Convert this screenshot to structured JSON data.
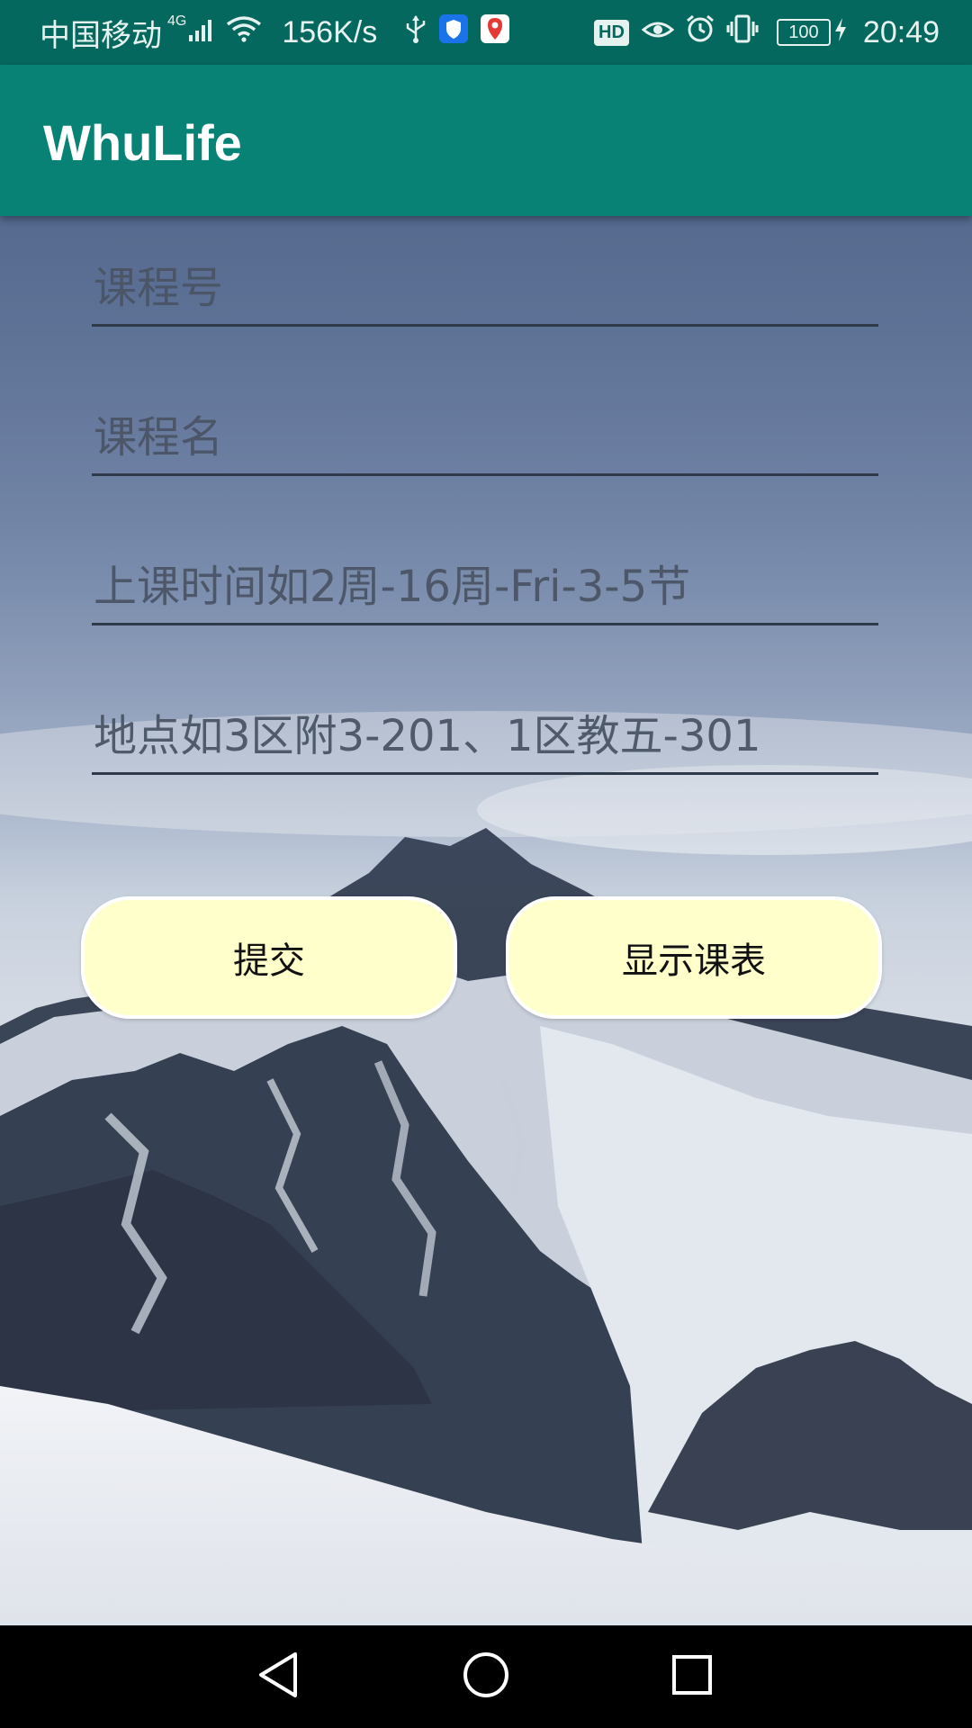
{
  "status_bar": {
    "carrier": "中国移动",
    "network_type": "4G",
    "net_speed": "156K/s",
    "hd_badge": "HD",
    "battery_level": "100",
    "time": "20:49",
    "icons": [
      "signal-icon",
      "wifi-icon",
      "usb-icon",
      "shield-app-icon",
      "map-app-icon",
      "eye-icon",
      "alarm-icon",
      "vibrate-icon",
      "battery-icon",
      "charging-icon"
    ]
  },
  "app_bar": {
    "title": "WhuLife"
  },
  "form": {
    "course_number_placeholder": "课程号",
    "course_name_placeholder": "课程名",
    "class_time_placeholder": "上课时间如2周-16周-Fri-3-5节",
    "location_placeholder": "地点如3区附3-201、1区教五-301"
  },
  "buttons": {
    "submit_label": "提交",
    "show_schedule_label": "显示课表"
  },
  "nav_bar": {
    "icons": [
      "back-icon",
      "home-icon",
      "recents-icon"
    ]
  },
  "colors": {
    "status_bar": "#05685f",
    "app_bar": "#078275",
    "button_fill": "#ffffcc",
    "button_border": "#ffffff"
  }
}
